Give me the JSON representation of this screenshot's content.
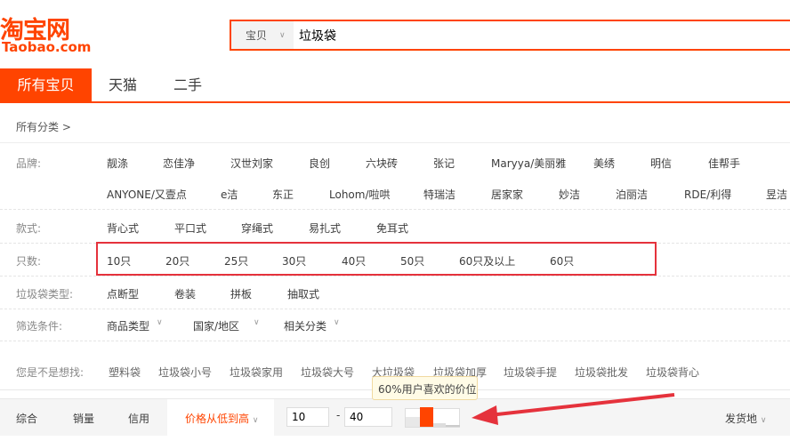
{
  "logo": {
    "cn": "淘宝网",
    "en": "Taobao.com"
  },
  "search": {
    "scope": "宝贝",
    "query": "垃圾袋"
  },
  "tabs": [
    "所有宝贝",
    "天猫",
    "二手"
  ],
  "breadcrumb": "所有分类 >",
  "filters": {
    "brand": {
      "label": "品牌:",
      "row1": [
        "靓涤",
        "恋佳净",
        "汉世刘家",
        "良创",
        "六块砖",
        "张记",
        "Maryya/美丽雅",
        "美绣",
        "明信",
        "佳帮手"
      ],
      "row2": [
        "ANYONE/又壹点",
        "e洁",
        "东正",
        "Lohom/啦哄",
        "特瑞洁",
        "居家家",
        "妙洁",
        "泊丽洁",
        "RDE/利得",
        "昱洁"
      ]
    },
    "style": {
      "label": "款式:",
      "items": [
        "背心式",
        "平口式",
        "穿绳式",
        "易扎式",
        "免耳式"
      ]
    },
    "count": {
      "label": "只数:",
      "items": [
        "10只",
        "20只",
        "25只",
        "30只",
        "40只",
        "50只",
        "60只及以上",
        "60只"
      ]
    },
    "type": {
      "label": "垃圾袋类型:",
      "items": [
        "点断型",
        "卷装",
        "拼板",
        "抽取式"
      ]
    },
    "conditions": {
      "label": "筛选条件:",
      "items": [
        "商品类型",
        "国家/地区",
        "相关分类"
      ]
    }
  },
  "suggest": {
    "label": "您是不是想找:",
    "items": [
      "塑料袋",
      "垃圾袋小号",
      "垃圾袋家用",
      "垃圾袋大号",
      "大垃圾袋",
      "垃圾袋加厚",
      "垃圾袋手提",
      "垃圾袋批发",
      "垃圾袋背心"
    ]
  },
  "sort": {
    "items": [
      "综合",
      "销量",
      "信用"
    ],
    "active": "价格从低到高",
    "price_min": "10",
    "price_max": "40",
    "dash": "-",
    "location": "发货地"
  },
  "tooltip": "60%用户喜欢的价位",
  "colors": {
    "accent": "#ff4400",
    "annotation": "#e5323c"
  }
}
